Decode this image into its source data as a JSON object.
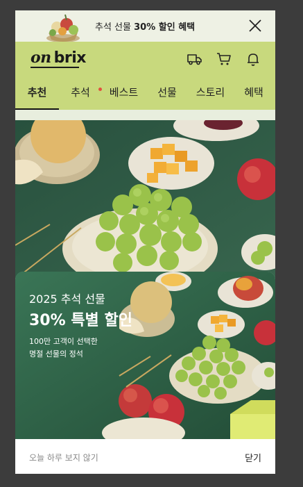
{
  "banner": {
    "text_prefix": "추석 선물 ",
    "text_bold": "30% 할인 혜택"
  },
  "header": {
    "logo_on": "on",
    "logo_brix": "brix"
  },
  "tabs": [
    {
      "label": "추천",
      "active": true
    },
    {
      "label": "추석",
      "dot": true
    },
    {
      "label": "베스트"
    },
    {
      "label": "선물"
    },
    {
      "label": "스토리"
    },
    {
      "label": "혜택"
    }
  ],
  "popup": {
    "year_line": "2025 추석 선물",
    "title": "30% 특별 할인",
    "desc_line1": "100만 고객이 선택한",
    "desc_line2": "명절 선물의 정석",
    "dont_show_today": "오늘 하루 보지 않기",
    "close": "닫기"
  },
  "colors": {
    "header_bg": "#c8d97d",
    "hero_bg": "#2e5a45",
    "tab_dot": "#e2503f"
  }
}
